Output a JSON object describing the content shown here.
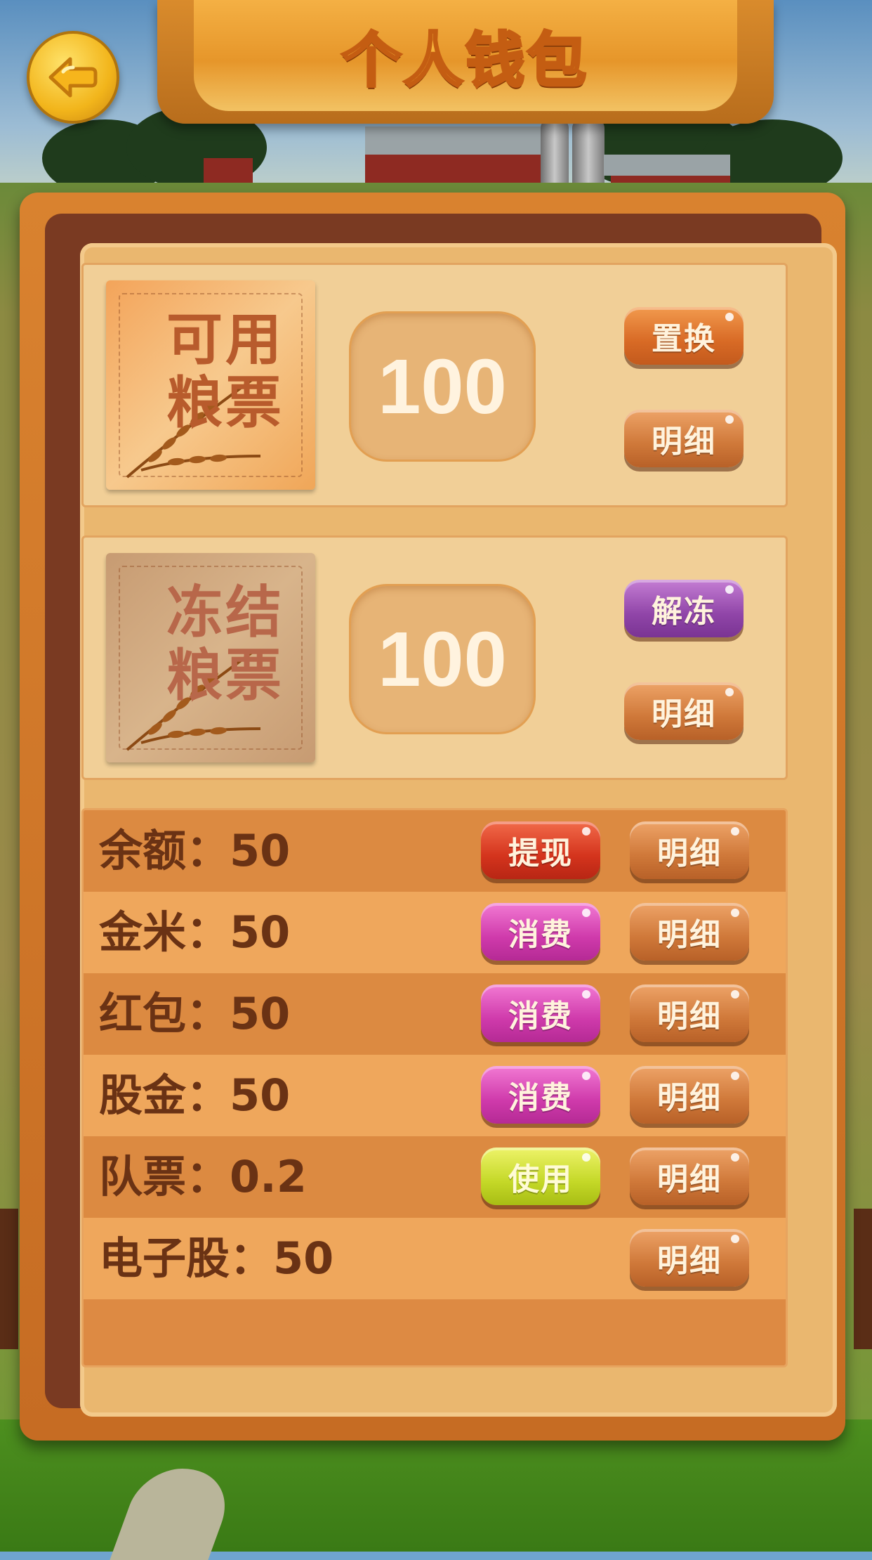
{
  "header": {
    "title": "个人钱包",
    "back_icon": "back-arrow-icon"
  },
  "cards": [
    {
      "ticket_label": "可用粮票",
      "ticket_line1": "可用",
      "ticket_line2": "粮票",
      "amount": "100",
      "action_label": "置换",
      "detail_label": "明细"
    },
    {
      "ticket_label": "冻结粮票",
      "ticket_line1": "冻结",
      "ticket_line2": "粮票",
      "amount": "100",
      "action_label": "解冻",
      "detail_label": "明细"
    }
  ],
  "rows": [
    {
      "label": "余额：50",
      "action_label": "提现",
      "action_color": "#d4341d",
      "detail_label": "明细"
    },
    {
      "label": "金米：50",
      "action_label": "消费",
      "action_color": "#cf3aab",
      "detail_label": "明细"
    },
    {
      "label": "红包：50",
      "action_label": "消费",
      "action_color": "#cf3aab",
      "detail_label": "明细"
    },
    {
      "label": "股金：50",
      "action_label": "消费",
      "action_color": "#cf3aab",
      "detail_label": "明细"
    },
    {
      "label": "队票：0.2",
      "action_label": "使用",
      "action_color": "#c4d827",
      "detail_label": "明细"
    },
    {
      "label": "电子股：50",
      "action_label": null,
      "detail_label": "明细"
    }
  ],
  "colors": {
    "panel": "#eab76f",
    "frame": "#c66c23",
    "text_dark": "#6a3214"
  }
}
